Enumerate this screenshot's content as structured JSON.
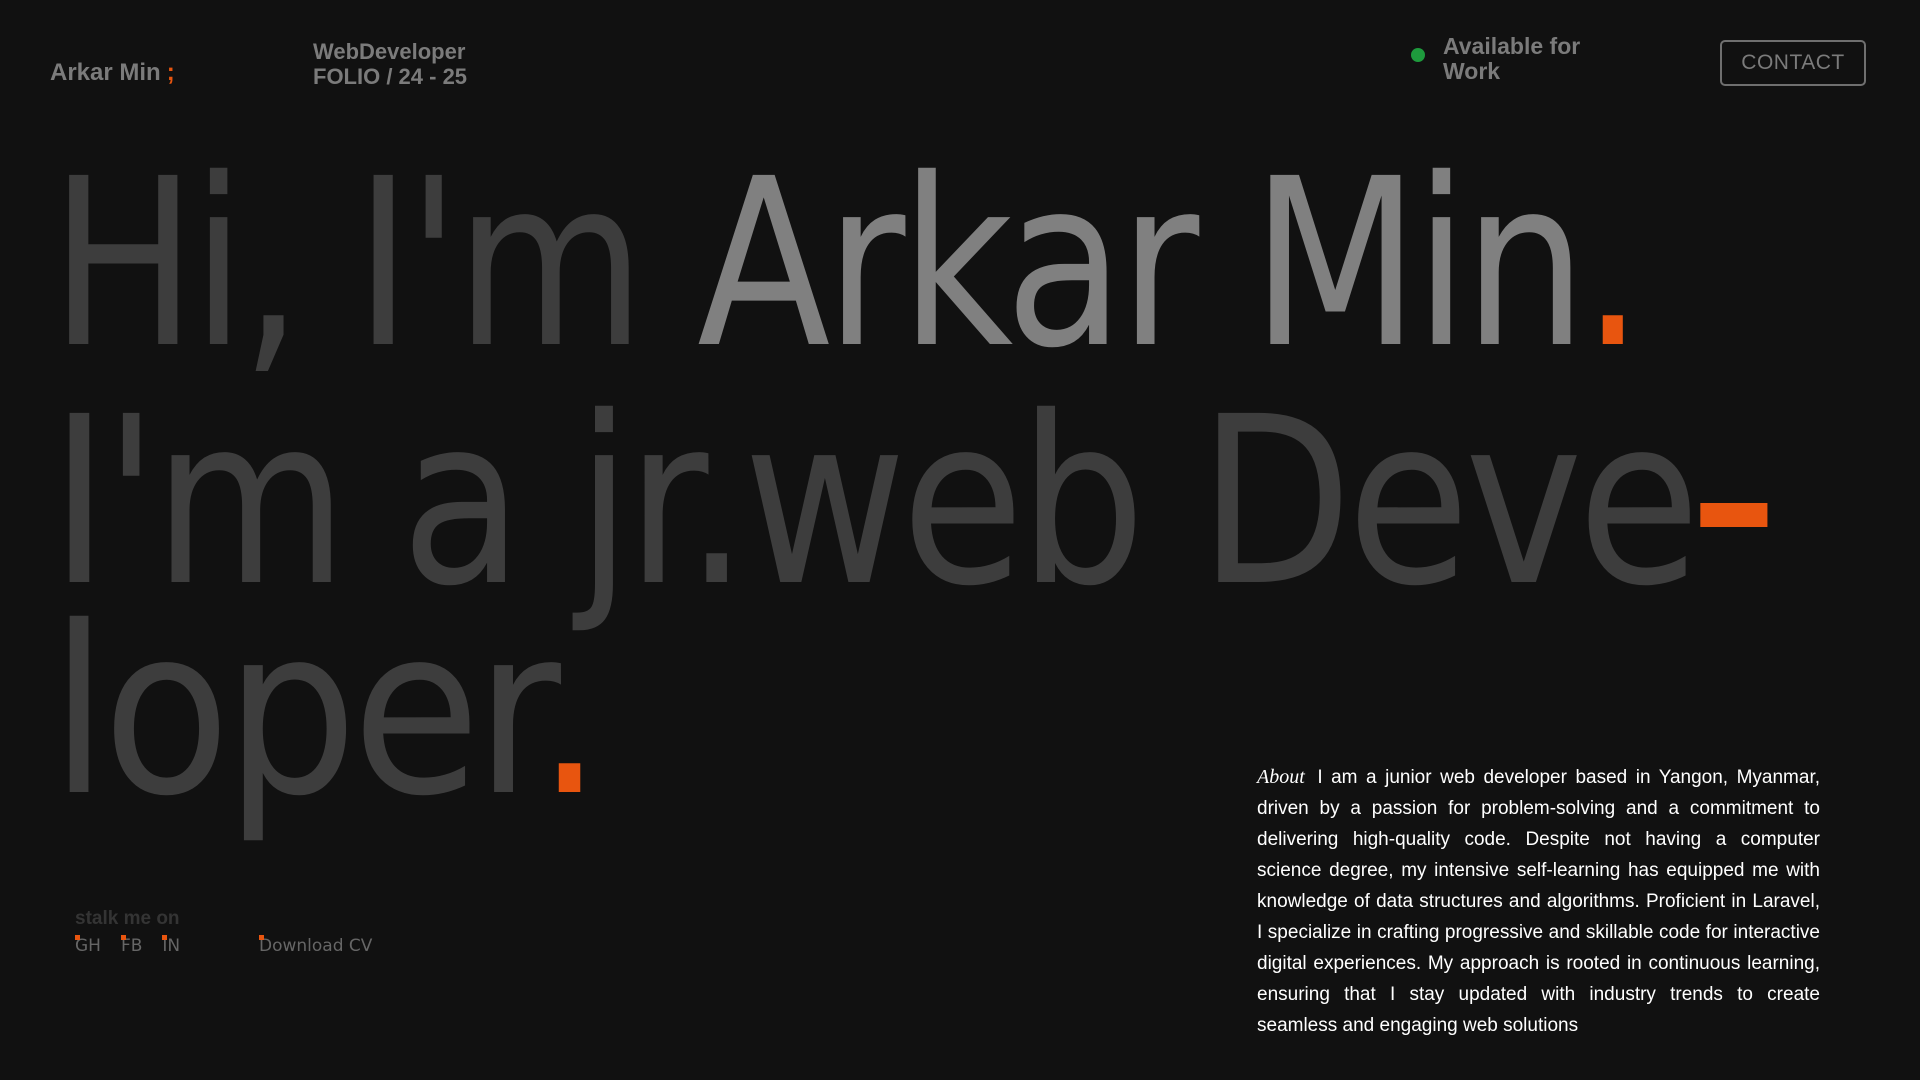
{
  "header": {
    "brand_name": "Arkar Min",
    "brand_mark": ";",
    "role_line_1": "WebDeveloper",
    "role_line_2": "FOLIO / 24 - 25",
    "availability": "Available for Work",
    "contact_label": "CONTACT"
  },
  "hero": {
    "line1_dim": "Hi, I'm ",
    "line1_name": "Arkar Min",
    "line1_period": ".",
    "line2": "I'm a jr.web Deve",
    "line3": "loper",
    "line3_period": "."
  },
  "social": {
    "heading": "stalk me on",
    "links": [
      "GH",
      "FB",
      "IN"
    ],
    "cv_label": "Download CV"
  },
  "about": {
    "label": "About",
    "text": "I am a junior web developer based in Yangon, Myanmar, driven by a passion for problem-solving and a commitment to delivering high-quality code. Despite not having a computer science degree, my intensive self-learning has equipped me with knowledge of data structures and algorithms. Proficient in Laravel, I specialize in crafting progressive and skillable code for interactive digital experiences. My approach is rooted in continuous learning, ensuring that I stay updated with industry trends to create seamless and engaging web solutions"
  },
  "colors": {
    "background": "#111111",
    "accent": "#e8550f",
    "status": "#1e9b3d",
    "muted_text": "#7b7b7b",
    "dim_text": "#3d3d3d"
  }
}
